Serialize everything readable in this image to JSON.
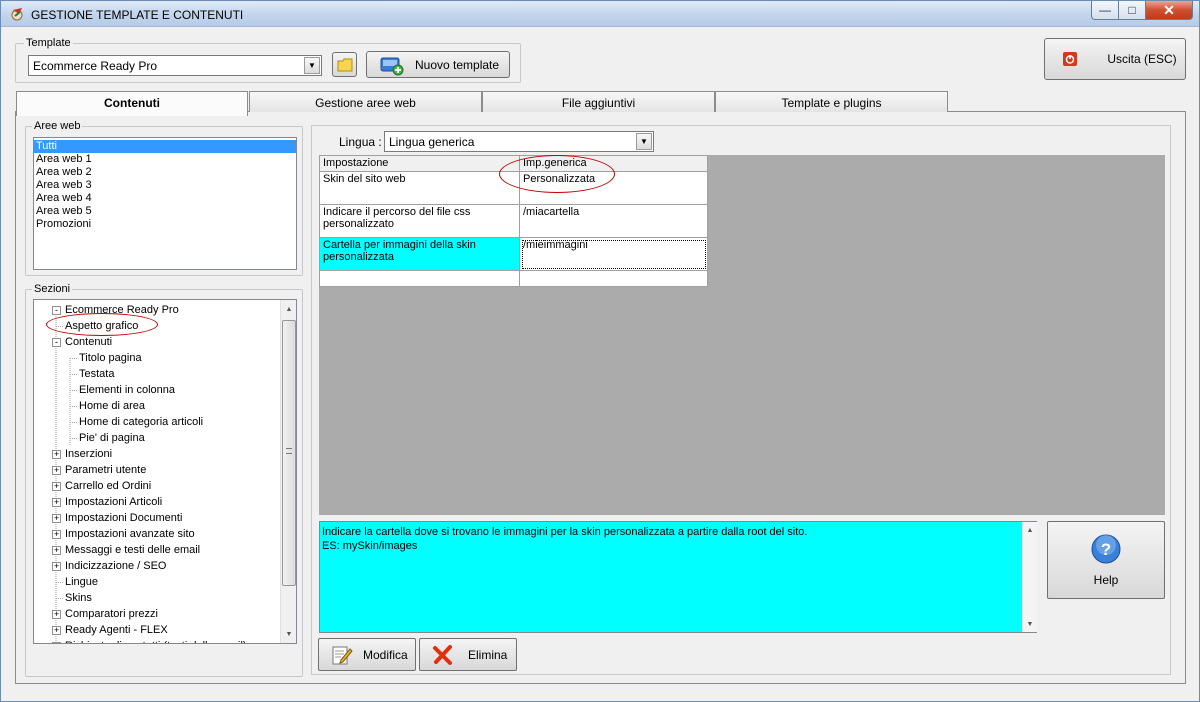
{
  "window": {
    "title": "GESTIONE TEMPLATE E CONTENUTI"
  },
  "template": {
    "group_label": "Template",
    "selected": "Ecommerce Ready Pro",
    "new_button": "Nuovo template"
  },
  "exit_button": "Uscita (ESC)",
  "tabs": [
    {
      "label": "Contenuti"
    },
    {
      "label": "Gestione aree web"
    },
    {
      "label": "File aggiuntivi"
    },
    {
      "label": "Template e plugins"
    }
  ],
  "aree_web": {
    "label": "Aree web",
    "items": [
      "Tutti",
      "Area web 1",
      "Area web 2",
      "Area web 3",
      "Area web 4",
      "Area web 5",
      "Promozioni"
    ],
    "selected": "Tutti"
  },
  "sezioni": {
    "label": "Sezioni",
    "tree": [
      {
        "text": "Ecommerce Ready Pro",
        "expander": "-"
      },
      {
        "text": "Aspetto grafico",
        "expander": ""
      },
      {
        "text": "Contenuti",
        "expander": "-"
      },
      {
        "text": "Titolo pagina",
        "expander": ""
      },
      {
        "text": "Testata",
        "expander": ""
      },
      {
        "text": "Elementi in colonna",
        "expander": ""
      },
      {
        "text": "Home di area",
        "expander": ""
      },
      {
        "text": "Home di categoria articoli",
        "expander": ""
      },
      {
        "text": "Pie' di pagina",
        "expander": ""
      },
      {
        "text": "Inserzioni",
        "expander": "+"
      },
      {
        "text": "Parametri utente",
        "expander": "+"
      },
      {
        "text": "Carrello ed Ordini",
        "expander": "+"
      },
      {
        "text": "Impostazioni Articoli",
        "expander": "+"
      },
      {
        "text": "Impostazioni Documenti",
        "expander": "+"
      },
      {
        "text": "Impostazioni avanzate sito",
        "expander": "+"
      },
      {
        "text": "Messaggi e testi delle email",
        "expander": "+"
      },
      {
        "text": "Indicizzazione / SEO",
        "expander": "+"
      },
      {
        "text": "Lingue",
        "expander": ""
      },
      {
        "text": "Skins",
        "expander": ""
      },
      {
        "text": "Comparatori prezzi",
        "expander": "+"
      },
      {
        "text": "Ready Agenti - FLEX",
        "expander": "+"
      },
      {
        "text": "Richiesta di contatti (testi delle email)",
        "expander": "+"
      }
    ]
  },
  "lingua": {
    "label": "Lingua :",
    "selected": "Lingua generica"
  },
  "grid": {
    "headers": [
      "Impostazione",
      "Imp.generica"
    ],
    "rows": [
      [
        "Skin del sito web",
        "Personalizzata"
      ],
      [
        "Indicare il percorso del file css personalizzato",
        "/miacartella"
      ],
      [
        "Cartella per immagini della skin personalizzata",
        "/mieimmagini"
      ],
      [
        "",
        ""
      ]
    ]
  },
  "description": {
    "line1": "Indicare la cartella dove si trovano le immagini per la skin personalizzata a partire dalla root del sito.",
    "line2": "ES: mySkin/images"
  },
  "buttons": {
    "modifica": "Modifica",
    "elimina": "Elimina",
    "help": "Help"
  },
  "colors": {
    "selection": "#3399ff",
    "highlight": "#00ffff",
    "annotation": "#c00000"
  }
}
